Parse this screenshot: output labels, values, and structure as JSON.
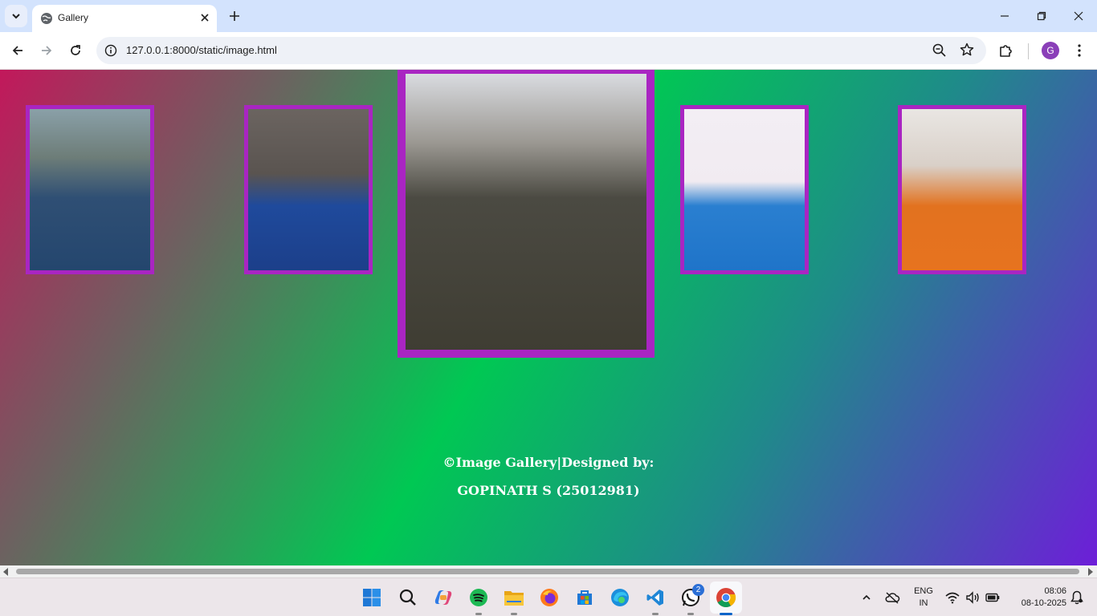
{
  "browser": {
    "tab_title": "Gallery",
    "url": "127.0.0.1:8000/static/image.html",
    "profile_initial": "G"
  },
  "gallery": {
    "border_color": "#a925c2",
    "images": [
      {
        "name": "portrait-young-man-blue-shirt",
        "bg": "linear-gradient(180deg,#8aa0a8 0%,#6d7d78 30%,#2f4f74 55%,#24466e 100%)"
      },
      {
        "name": "portrait-cricketer-blue-jersey",
        "bg": "linear-gradient(180deg,#6b6460 0%,#5a5450 40%,#1f4a9c 60%,#1c3f8a 100%)"
      },
      {
        "name": "portrait-man-plaid-shirt",
        "bg": "linear-gradient(180deg,#d9dbe0 0%,#9b9892 25%,#4b4a42 45%,#3f3d33 100%)"
      },
      {
        "name": "portrait-cricketer-oppo-jersey",
        "bg": "linear-gradient(180deg,#f3eef4 0%,#f1ebf1 45%,#2a7fd0 60%,#1f74c9 100%)"
      },
      {
        "name": "portrait-cricketer-orange-jersey",
        "bg": "linear-gradient(180deg,#e9e6e3 0%,#d9d0c8 35%,#e2721f 60%,#e7731f 100%)"
      }
    ]
  },
  "footer": {
    "line1": "©Image Gallery|Designed by:",
    "line2": "GOPINATH S (25012981)"
  },
  "taskbar": {
    "whatsapp_badge": "2",
    "lang_line1": "ENG",
    "lang_line2": "IN",
    "time": "08:06",
    "date": "08-10-2025"
  }
}
